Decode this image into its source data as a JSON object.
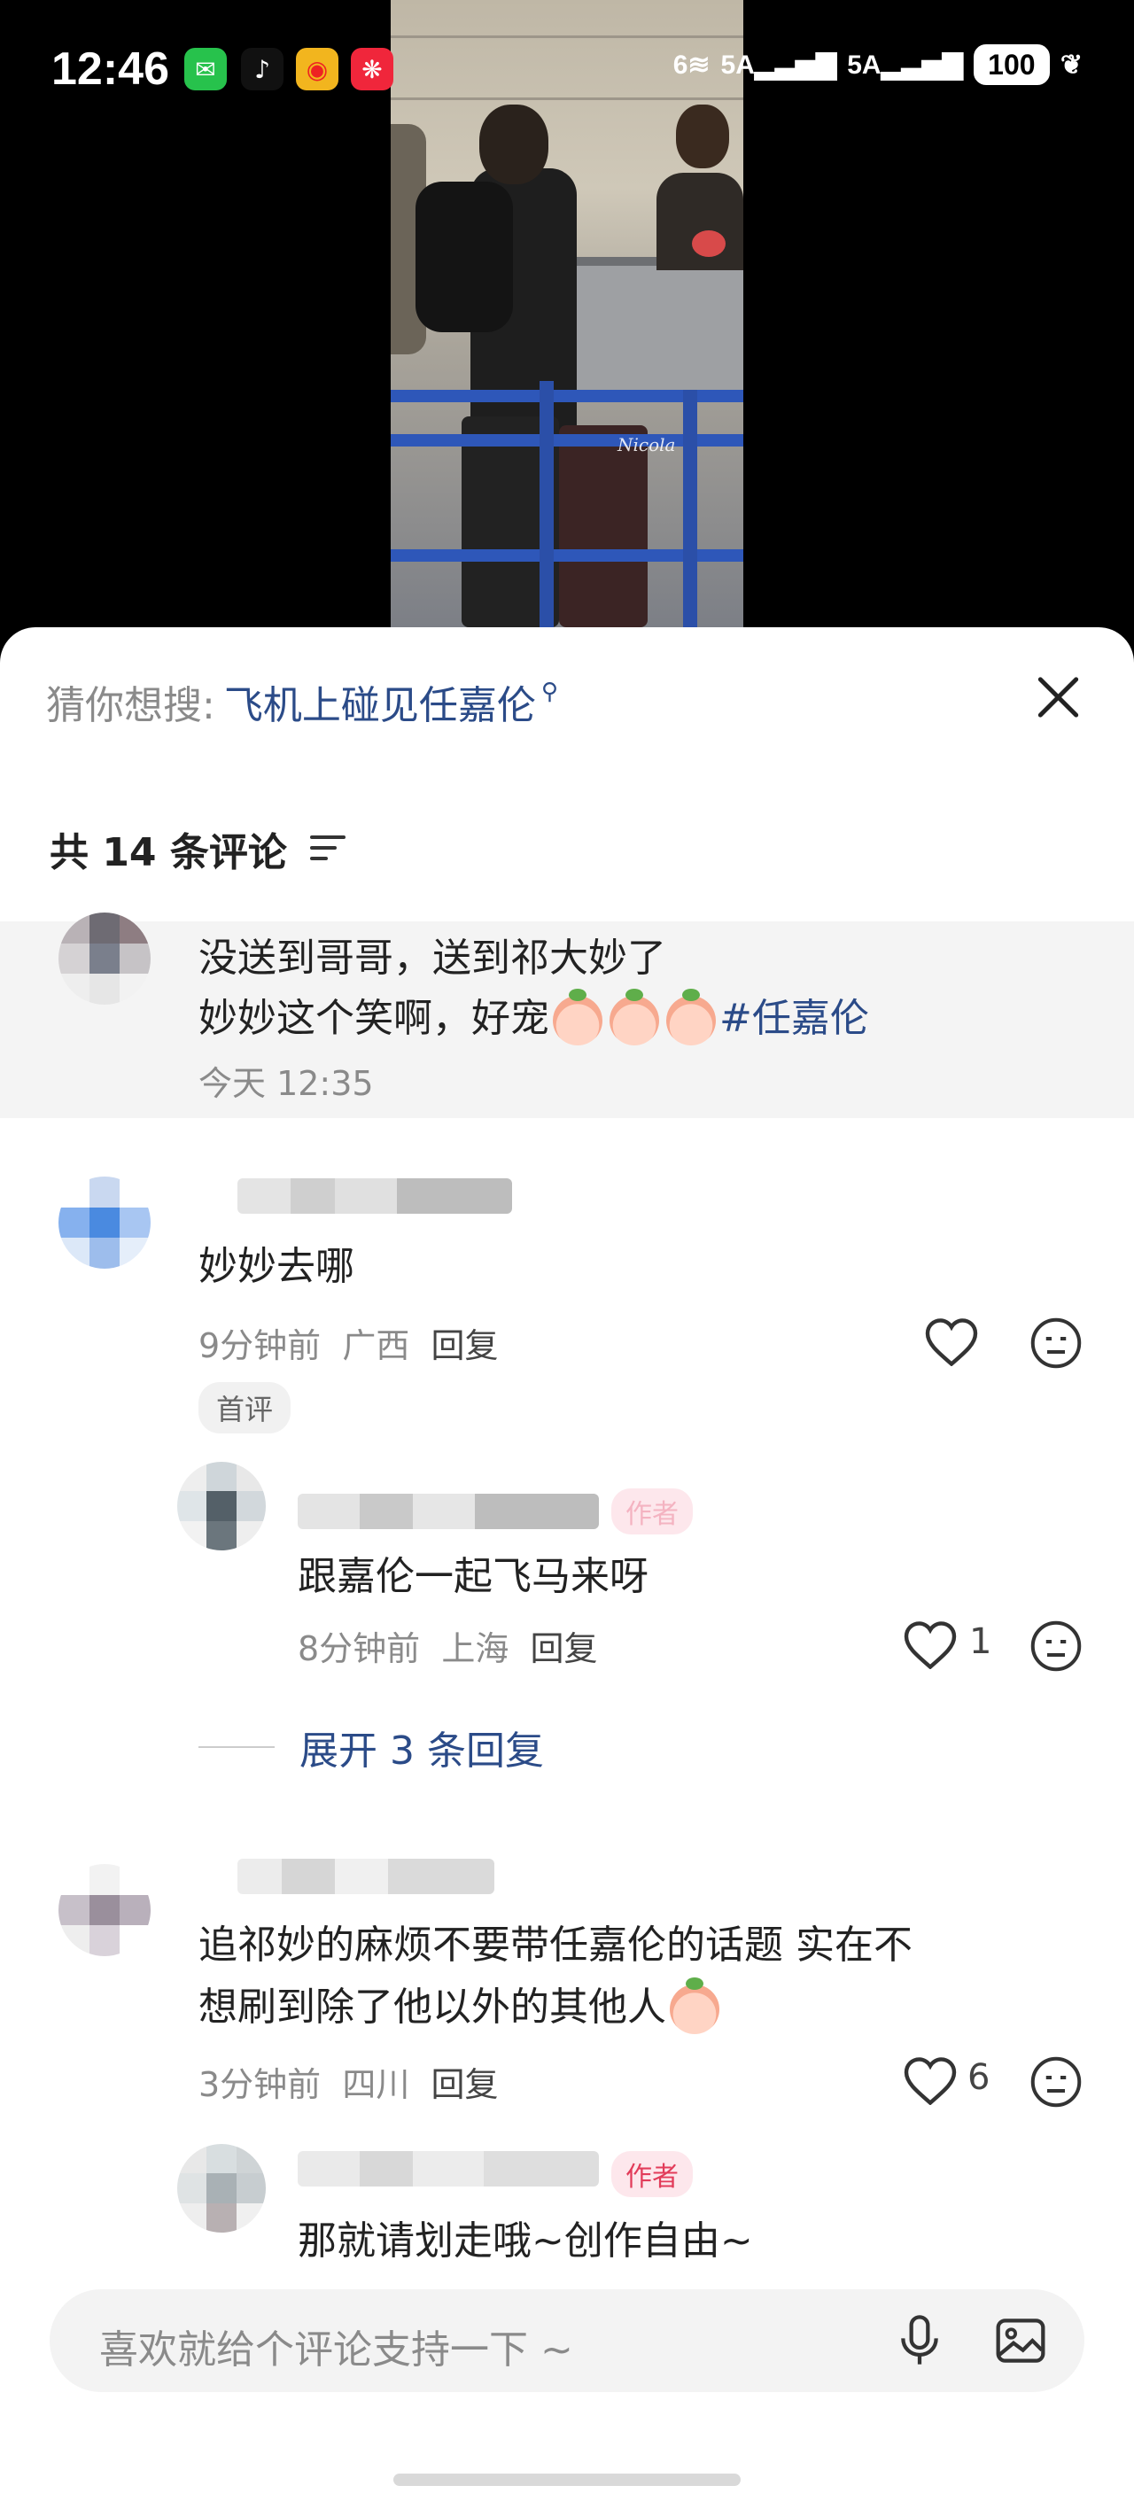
{
  "status_bar": {
    "time": "12:46",
    "apps": [
      "wechat-icon",
      "tiktok-icon",
      "weibo-icon",
      "xiaohongshu-icon"
    ],
    "signal_1": "6",
    "signal_2": "5A",
    "signal_3": "5A",
    "battery": "100"
  },
  "video": {
    "watermark": "Nicola"
  },
  "sheet": {
    "suggest_label": "猜你想搜:",
    "suggest_query": "飞机上碰见任嘉伦",
    "comment_count": "共 14 条评论"
  },
  "pinned_comment": {
    "line1": "没送到哥哥，送到祁大妙了",
    "line2_text": "妙妙这个笑啊，好宠",
    "line2_topic": "#任嘉伦",
    "time": "今天 12:35"
  },
  "comments": [
    {
      "text": "妙妙去哪",
      "time": "9分钟前",
      "location": "广西",
      "reply": "回复",
      "tag": "首评",
      "likes": ""
    },
    {
      "text": "跟嘉伦一起飞马来呀",
      "time": "8分钟前",
      "location": "上海",
      "reply": "回复",
      "likes": "1"
    },
    {
      "text_line1": "追祁妙的麻烦不要带任嘉伦的话题 实在不",
      "text_line2": "想刷到除了他以外的其他人",
      "time": "3分钟前",
      "location": "四川",
      "reply": "回复",
      "likes": "6"
    },
    {
      "author_tag": "作者",
      "text": "那就请划走哦~创作自由~"
    }
  ],
  "expand_replies": "展开 3 条回复",
  "input": {
    "placeholder": "喜欢就给个评论支持一下 ~"
  },
  "colors": {
    "link": "#2b4b88",
    "author_tag": "#e23c5a",
    "sheet_bg": "#ffffff",
    "pinned_bg": "#f4f4f4"
  }
}
